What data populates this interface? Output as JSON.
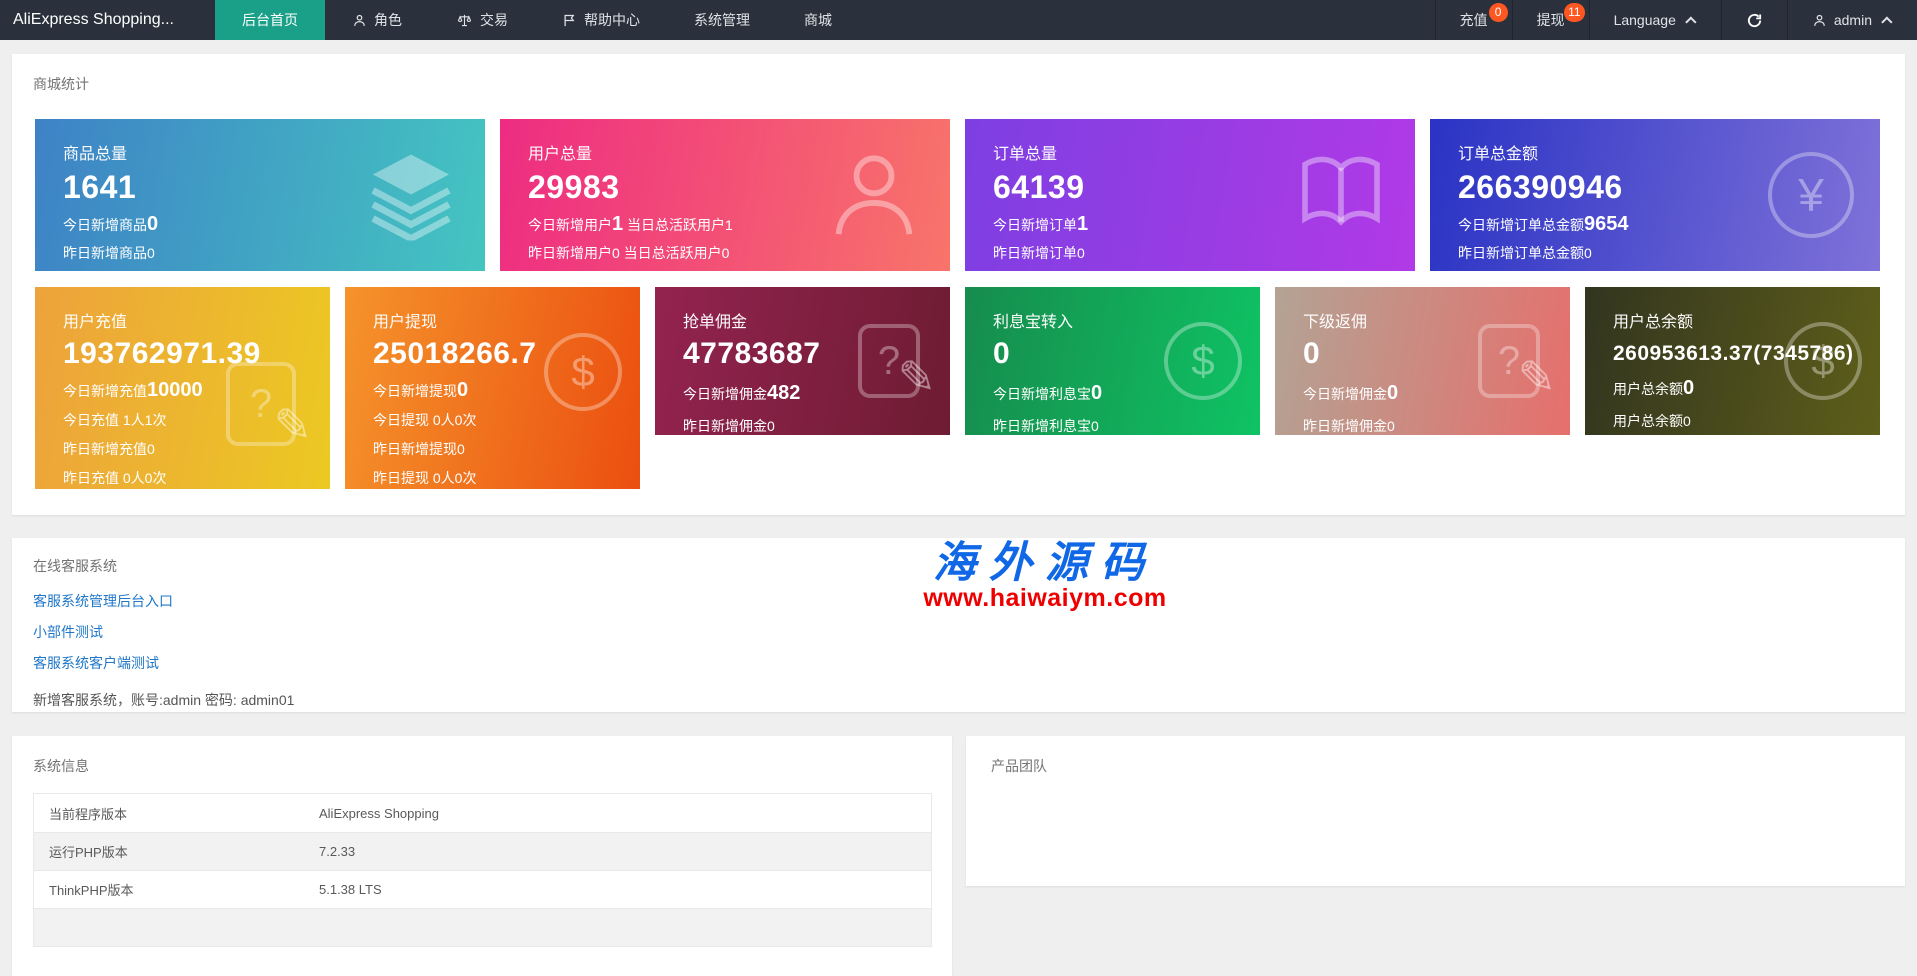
{
  "colors": {
    "navbar_bg": "#2b313c",
    "accent_teal": "#1aa088",
    "badge_red": "#ff5722",
    "link_blue": "#2077c8",
    "watermark_blue": "#1068e6",
    "watermark_red": "#ee0000"
  },
  "icons": {
    "yen": "¥",
    "dollar": "$",
    "question": "?",
    "pencil": "✎"
  },
  "navbar": {
    "title": "AliExpress Shopping...",
    "menu": [
      {
        "label": "后台首页",
        "active": true
      },
      {
        "label": "角色",
        "icon": "user-icon"
      },
      {
        "label": "交易",
        "icon": "scales-icon"
      },
      {
        "label": "帮助中心",
        "icon": "flag-icon"
      },
      {
        "label": "系统管理"
      },
      {
        "label": "商城"
      }
    ],
    "right": {
      "recharge": {
        "label": "充值",
        "badge": "0"
      },
      "withdraw": {
        "label": "提现",
        "badge": "11"
      },
      "language": {
        "label": "Language"
      },
      "user": {
        "label": "admin"
      }
    }
  },
  "stats": {
    "title": "商城统计",
    "row1": [
      {
        "title": "商品总量",
        "value": "1641",
        "grad": [
          "#3e82c6",
          "#44c5c1"
        ],
        "icon": "layers-icon",
        "lines": [
          {
            "pre": "今日新增商品",
            "big": "0",
            "post": ""
          },
          {
            "pre": "昨日新增商品0",
            "big": "",
            "post": ""
          }
        ]
      },
      {
        "title": "用户总量",
        "value": "29983",
        "grad": [
          "#ee2c82",
          "#f8746a"
        ],
        "icon": "user-icon",
        "lines": [
          {
            "pre": "今日新增用户",
            "big": "1",
            "post": " 当日总活跃用户1"
          },
          {
            "pre": "昨日新增用户0 当日总活跃用户0",
            "big": "",
            "post": ""
          }
        ]
      },
      {
        "title": "订单总量",
        "value": "64139",
        "grad": [
          "#7d3fe2",
          "#b13ae6"
        ],
        "icon": "book-icon",
        "lines": [
          {
            "pre": "今日新增订单",
            "big": "1",
            "post": ""
          },
          {
            "pre": "昨日新增订单0",
            "big": "",
            "post": ""
          }
        ]
      },
      {
        "title": "订单总金额",
        "value": "266390946",
        "grad": [
          "#2a33c4",
          "#7f72d9"
        ],
        "icon": "yen-circle-icon",
        "lines": [
          {
            "pre": "今日新增订单总金额",
            "big": "9654",
            "post": ""
          },
          {
            "pre": "昨日新增订单总金额0",
            "big": "",
            "post": ""
          }
        ]
      }
    ],
    "row2": [
      {
        "title": "用户充值",
        "value": "193762971.39",
        "grad": [
          "#eda23c",
          "#ecc922"
        ],
        "icon": "edit-doc-icon",
        "lines": [
          {
            "pre": "今日新增充值",
            "big": "10000",
            "post": ""
          },
          {
            "pre": "今日充值 1人1次",
            "big": "",
            "post": ""
          },
          {
            "pre": "昨日新增充值0",
            "big": "",
            "post": ""
          },
          {
            "pre": "昨日充值 0人0次",
            "big": "",
            "post": ""
          }
        ]
      },
      {
        "title": "用户提现",
        "value": "25018266.7",
        "grad": [
          "#f5932b",
          "#eb4f10"
        ],
        "icon": "dollar-circle-icon",
        "lines": [
          {
            "pre": "今日新增提现",
            "big": "0",
            "post": ""
          },
          {
            "pre": "今日提现 0人0次",
            "big": "",
            "post": ""
          },
          {
            "pre": "昨日新增提现0",
            "big": "",
            "post": ""
          },
          {
            "pre": "昨日提现 0人0次",
            "big": "",
            "post": ""
          }
        ]
      },
      {
        "title": "抢单佣金",
        "value": "47783687",
        "grad": [
          "#93234f",
          "#6e1c33"
        ],
        "icon": "edit-doc-icon",
        "lines": [
          {
            "pre": "今日新增佣金",
            "big": "482",
            "post": ""
          },
          {
            "pre": "昨日新增佣金0",
            "big": "",
            "post": ""
          }
        ]
      },
      {
        "title": "利息宝转入",
        "value": "0",
        "grad": [
          "#168c4d",
          "#0fc364"
        ],
        "icon": "dollar-circle-icon",
        "lines": [
          {
            "pre": "今日新增利息宝",
            "big": "0",
            "post": ""
          },
          {
            "pre": "昨日新增利息宝0",
            "big": "",
            "post": ""
          }
        ]
      },
      {
        "title": "下级返佣",
        "value": "0",
        "grad": [
          "#b3a394",
          "#e66f6c"
        ],
        "icon": "edit-doc-icon",
        "lines": [
          {
            "pre": "今日新增佣金",
            "big": "0",
            "post": ""
          },
          {
            "pre": "昨日新增佣金0",
            "big": "",
            "post": ""
          }
        ]
      },
      {
        "title": "用户总余额",
        "value": "260953613.37(7345786)",
        "grad": [
          "#32351f",
          "#5e5e1a"
        ],
        "icon": "dollar-circle-icon",
        "lines": [
          {
            "pre": "用户总余额",
            "big": "0",
            "post": ""
          },
          {
            "pre": "用户总余额0",
            "big": "",
            "post": ""
          }
        ]
      }
    ]
  },
  "service": {
    "title": "在线客服系统",
    "links": [
      "客服系统管理后台入口",
      "小部件测试",
      "客服系统客户端测试"
    ],
    "note": "新增客服系统，账号:admin 密码: admin01",
    "watermark": {
      "line1": "海外源码",
      "line2": "www.haiwaiym.com"
    }
  },
  "system_info": {
    "title": "系统信息",
    "rows": [
      {
        "label": "当前程序版本",
        "value": "AliExpress Shopping"
      },
      {
        "label": "运行PHP版本",
        "value": "7.2.33"
      },
      {
        "label": "ThinkPHP版本",
        "value": "5.1.38 LTS"
      }
    ]
  },
  "team": {
    "title": "产品团队"
  }
}
